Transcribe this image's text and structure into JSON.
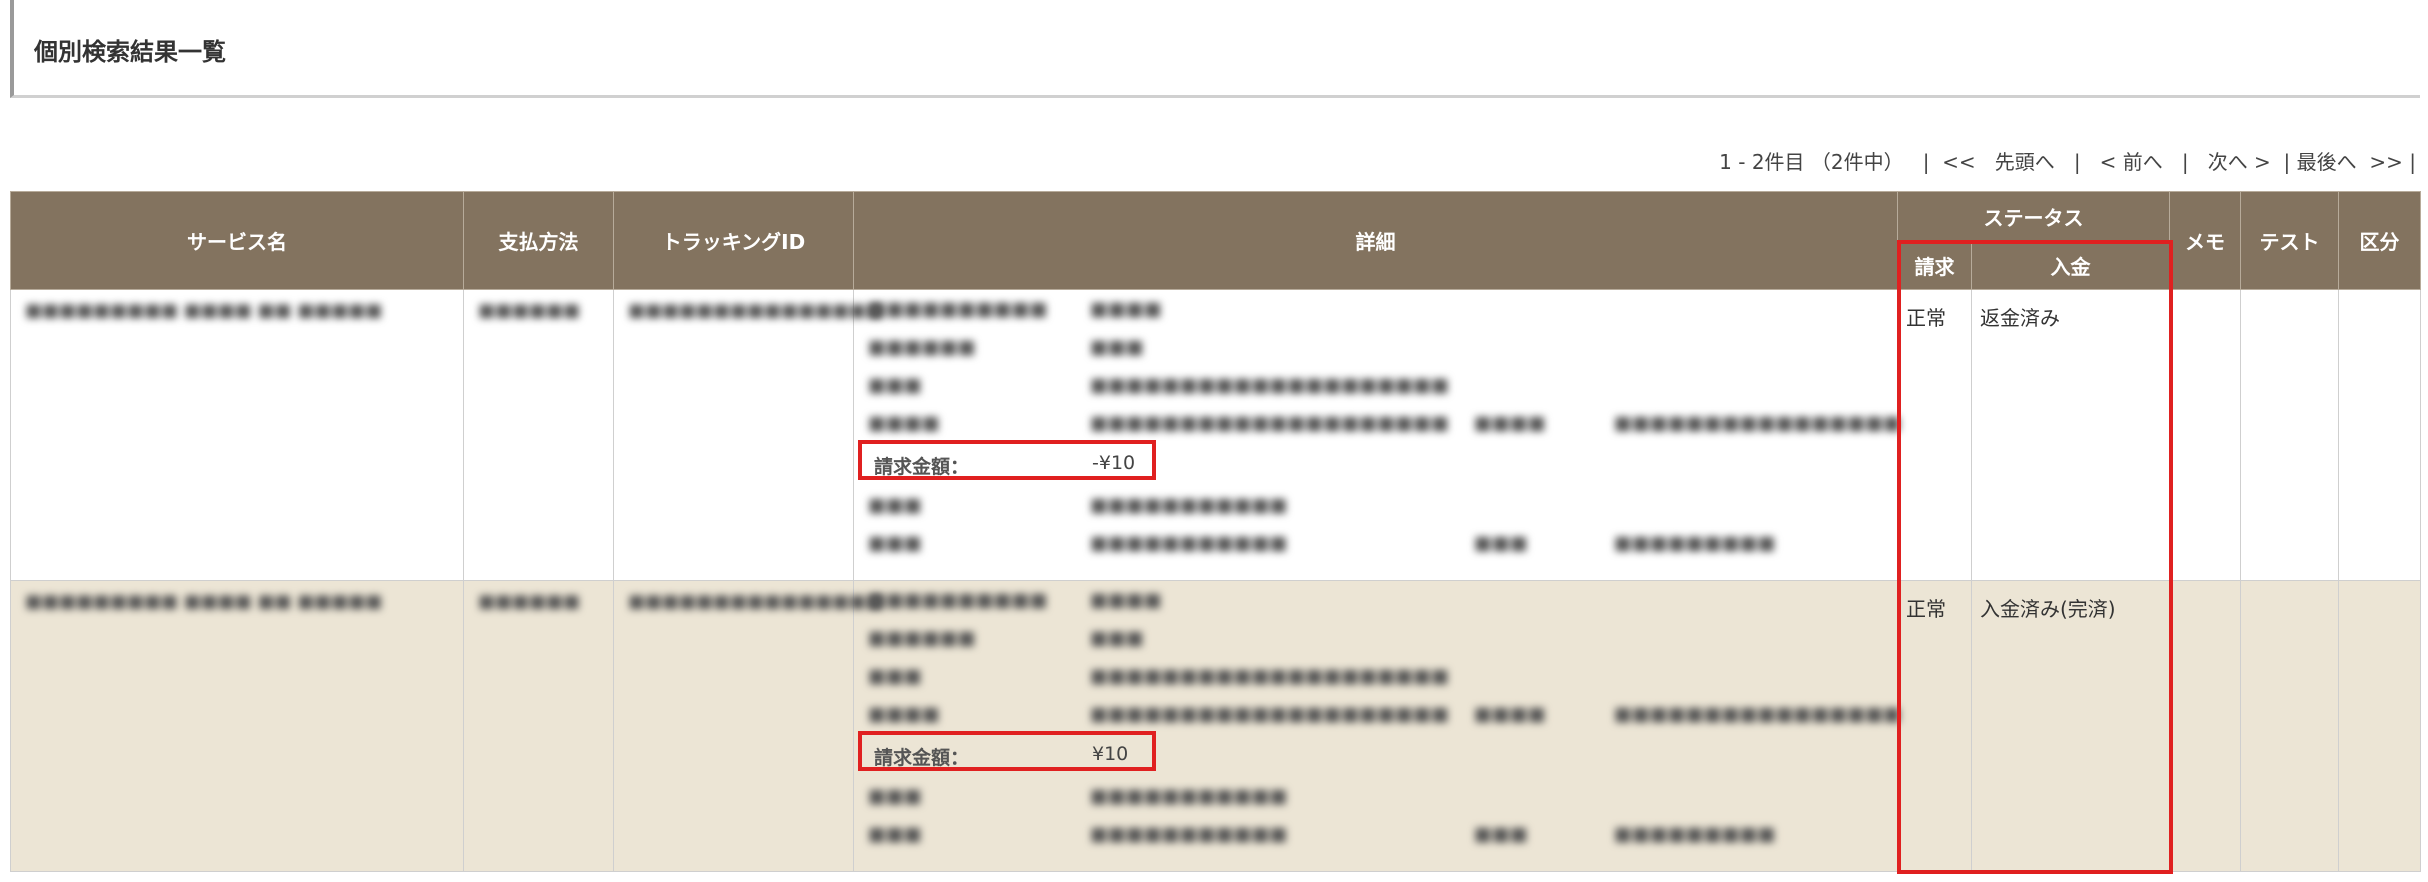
{
  "page_title": "個別検索結果一覧",
  "pager": {
    "range": "1 - 2件目 （2件中）",
    "sep": "|",
    "first_prefix": "<<",
    "first": "先頭へ",
    "prev": "< 前へ",
    "next": "次へ >",
    "last": "| 最後へ",
    "last_suffix": ">>",
    "end": "|"
  },
  "headers": {
    "service": "サービス名",
    "payment": "支払方法",
    "tracking": "トラッキングID",
    "detail": "詳細",
    "status": "ステータス",
    "billing": "請求",
    "deposit": "入金",
    "memo": "メモ",
    "test": "テスト",
    "category": "区分"
  },
  "rows": [
    {
      "service": "■■■■■■■■■ ■■■■ ■■ ■■■■■",
      "payment": "■■■■■■",
      "tracking": "■■■■■■■■■■■■■■■",
      "detail": {
        "l1": "■■■■■■■■■■",
        "v1": "■■■■",
        "l2": "■■■■■■",
        "v2": "■■■",
        "l3": "■■■",
        "v3": "■■■■■■■■■■■■■■■■■■■■",
        "l4": "■■■■",
        "v4": "■■■■■■■■■■■■■■■■■■■■",
        "l4b": "■■■■",
        "v4b": "■■■■■■■■■■■■■■■■",
        "amount_label": "請求金額：",
        "amount_value": "-¥10",
        "l6": "■■■",
        "v6": "■■■■■■■■■■■",
        "l7": "■■■",
        "v7": "■■■■■■■■■■■",
        "l7b": "■■■",
        "v7b": "■■■■■■■■■"
      },
      "billing": "正常",
      "deposit": "返金済み"
    },
    {
      "service": "■■■■■■■■■ ■■■■ ■■ ■■■■■",
      "payment": "■■■■■■",
      "tracking": "■■■■■■■■■■■■■■■",
      "detail": {
        "l1": "■■■■■■■■■■",
        "v1": "■■■■",
        "l2": "■■■■■■",
        "v2": "■■■",
        "l3": "■■■",
        "v3": "■■■■■■■■■■■■■■■■■■■■",
        "l4": "■■■■",
        "v4": "■■■■■■■■■■■■■■■■■■■■",
        "l4b": "■■■■",
        "v4b": "■■■■■■■■■■■■■■■■",
        "amount_label": "請求金額：",
        "amount_value": "¥10",
        "l6": "■■■",
        "v6": "■■■■■■■■■■■",
        "l7": "■■■",
        "v7": "■■■■■■■■■■■",
        "l7b": "■■■",
        "v7b": "■■■■■■■■■"
      },
      "billing": "正常",
      "deposit": "入金済み(完済)"
    }
  ]
}
